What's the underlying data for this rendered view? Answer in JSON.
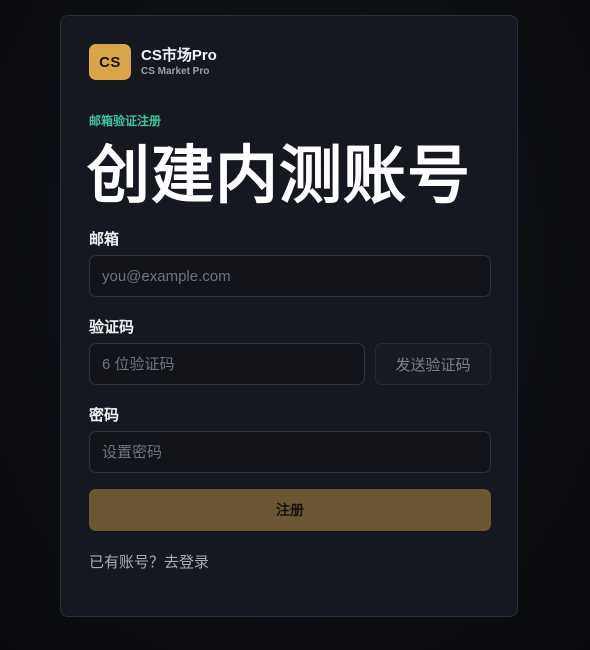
{
  "brand": {
    "logo_text": "CS",
    "name": "CS市场Pro",
    "subtitle": "CS Market Pro"
  },
  "eyebrow": "邮箱验证注册",
  "heading": "创建内测账号",
  "form": {
    "email": {
      "label": "邮箱",
      "value": "",
      "placeholder": "you@example.com"
    },
    "code": {
      "label": "验证码",
      "value": "",
      "placeholder": "6 位验证码",
      "send_label": "发送验证码"
    },
    "password": {
      "label": "密码",
      "value": "",
      "placeholder": "设置密码"
    },
    "submit_label": "注册"
  },
  "login_link": "已有账号？去登录",
  "colors": {
    "accent": "#d9a548",
    "eyebrow": "#3fc4a0",
    "submit_bg": "#6b5734",
    "card_bg": "#151820"
  }
}
